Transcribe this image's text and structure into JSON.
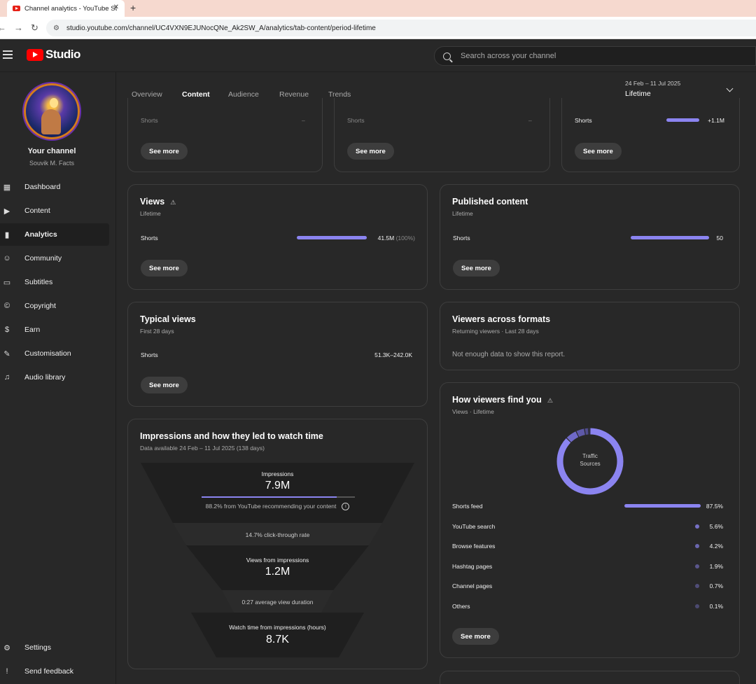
{
  "browser": {
    "tab_title": "Channel analytics - YouTube Studio",
    "tab_close": "✕",
    "new_tab": "+",
    "url": "studio.youtube.com/channel/UC4VXN9EJUNocQNe_Ak2SW_A/analytics/tab-content/period-lifetime"
  },
  "header": {
    "logo_text": "Studio",
    "search_placeholder": "Search across your channel"
  },
  "sidebar": {
    "channel_title": "Your channel",
    "channel_name": "Souvik M. Facts",
    "items": [
      {
        "label": "Dashboard",
        "icon": "dashboard-icon"
      },
      {
        "label": "Content",
        "icon": "content-icon"
      },
      {
        "label": "Analytics",
        "icon": "analytics-icon",
        "active": true
      },
      {
        "label": "Community",
        "icon": "community-icon"
      },
      {
        "label": "Subtitles",
        "icon": "subtitles-icon"
      },
      {
        "label": "Copyright",
        "icon": "copyright-icon"
      },
      {
        "label": "Earn",
        "icon": "earn-icon"
      },
      {
        "label": "Customisation",
        "icon": "customisation-icon"
      },
      {
        "label": "Audio library",
        "icon": "audio-library-icon"
      }
    ],
    "settings": "Settings",
    "feedback": "Send feedback"
  },
  "tabs": [
    "Overview",
    "Content",
    "Audience",
    "Revenue",
    "Trends"
  ],
  "date": {
    "range": "24 Feb – 11 Jul 2025",
    "label": "Lifetime"
  },
  "top_cards": [
    {
      "row": "Shorts",
      "value": "–",
      "button": "See more"
    },
    {
      "row": "Shorts",
      "value": "–",
      "button": "See more"
    },
    {
      "row": "Shorts",
      "value": "+1.1M",
      "button": "See more"
    }
  ],
  "views_card": {
    "title": "Views",
    "warning": "⚠",
    "subtitle": "Lifetime",
    "row": "Shorts",
    "value": "41.5M",
    "pct": "(100%)",
    "share": 1.0,
    "button": "See more"
  },
  "published_card": {
    "title": "Published content",
    "subtitle": "Lifetime",
    "row": "Shorts",
    "value": "50",
    "share": 1.0,
    "button": "See more"
  },
  "typical_card": {
    "title": "Typical views",
    "subtitle": "First 28 days",
    "row": "Shorts",
    "value": "51.3K–242.0K",
    "button": "See more"
  },
  "viewers_formats_card": {
    "title": "Viewers across formats",
    "subtitle": "Returning viewers · Last 28 days",
    "message": "Not enough data to show this report."
  },
  "impressions_card": {
    "title": "Impressions and how they led to watch time",
    "subtitle": "Data available 24 Feb – 11 Jul 2025 (138 days)",
    "impressions_label": "Impressions",
    "impressions_value": "7.9M",
    "recommend_share": 0.882,
    "recommend_text": "88.2% from YouTube recommending your content",
    "info": "i",
    "ctr_text": "14.7% click-through rate",
    "views_label": "Views from impressions",
    "views_value": "1.2M",
    "duration_text": "0:27 average view duration",
    "watch_label": "Watch time from impressions (hours)",
    "watch_value": "8.7K"
  },
  "traffic_card": {
    "title": "How viewers find you",
    "warning": "⚠",
    "subtitle": "Views · Lifetime",
    "donut_label_1": "Traffic",
    "donut_label_2": "Sources",
    "accent": "#8b84f0",
    "sources": [
      {
        "label": "Shorts feed",
        "value": "87.5%",
        "share": 0.875
      },
      {
        "label": "YouTube search",
        "value": "5.6%",
        "share": 0.056
      },
      {
        "label": "Browse features",
        "value": "4.2%",
        "share": 0.042
      },
      {
        "label": "Hashtag pages",
        "value": "1.9%",
        "share": 0.019
      },
      {
        "label": "Channel pages",
        "value": "0.7%",
        "share": 0.007
      },
      {
        "label": "Others",
        "value": "0.1%",
        "share": 0.001
      }
    ],
    "button": "See more"
  }
}
